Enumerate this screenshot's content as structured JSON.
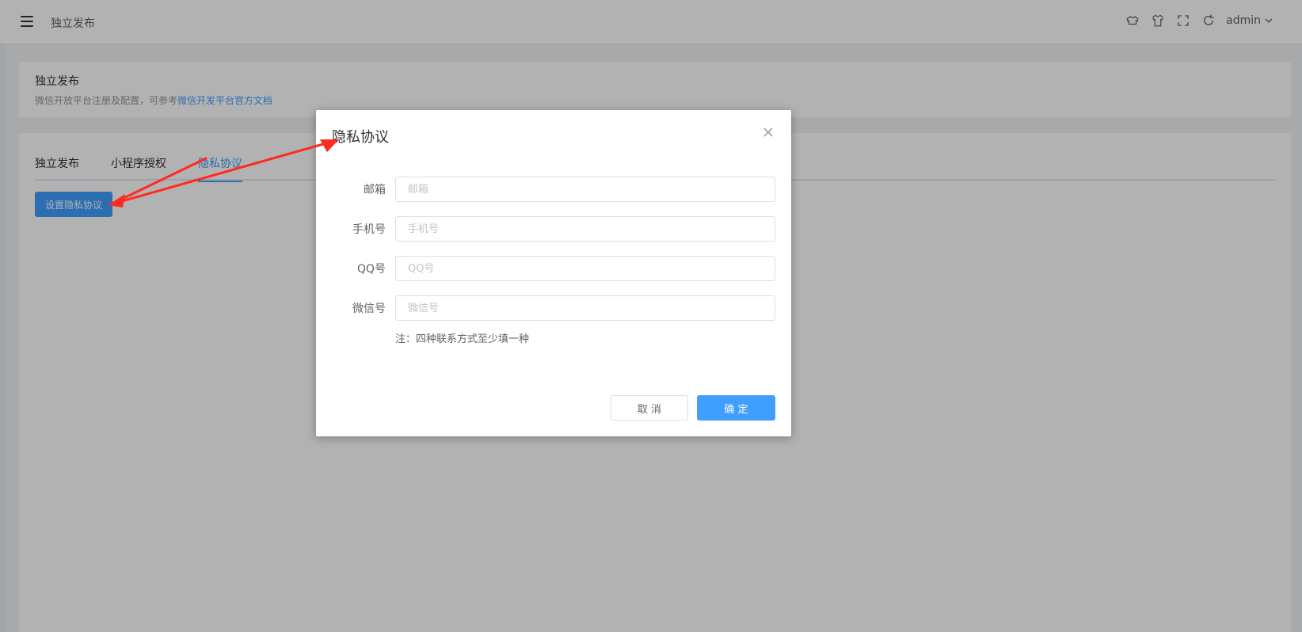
{
  "header": {
    "title": "独立发布",
    "user": "admin",
    "icons": [
      "shirt-alt-icon",
      "tshirt-icon",
      "fullscreen-icon",
      "refresh-icon"
    ]
  },
  "info": {
    "title": "独立发布",
    "desc_prefix": "微信开放平台注册及配置，可参考",
    "desc_link": "微信开发平台官方文档"
  },
  "tabs": [
    {
      "label": "独立发布",
      "active": false
    },
    {
      "label": "小程序授权",
      "active": false
    },
    {
      "label": "隐私协议",
      "active": true
    }
  ],
  "setup_button": "设置隐私协议",
  "dialog": {
    "title": "隐私协议",
    "fields": [
      {
        "label": "邮箱",
        "placeholder": "邮箱",
        "value": ""
      },
      {
        "label": "手机号",
        "placeholder": "手机号",
        "value": ""
      },
      {
        "label": "QQ号",
        "placeholder": "QQ号",
        "value": ""
      },
      {
        "label": "微信号",
        "placeholder": "微信号",
        "value": ""
      }
    ],
    "note": "注：四种联系方式至少填一种",
    "cancel": "取 消",
    "confirm": "确 定"
  },
  "colors": {
    "primary": "#409eff",
    "annotation": "#ff2a1f"
  }
}
